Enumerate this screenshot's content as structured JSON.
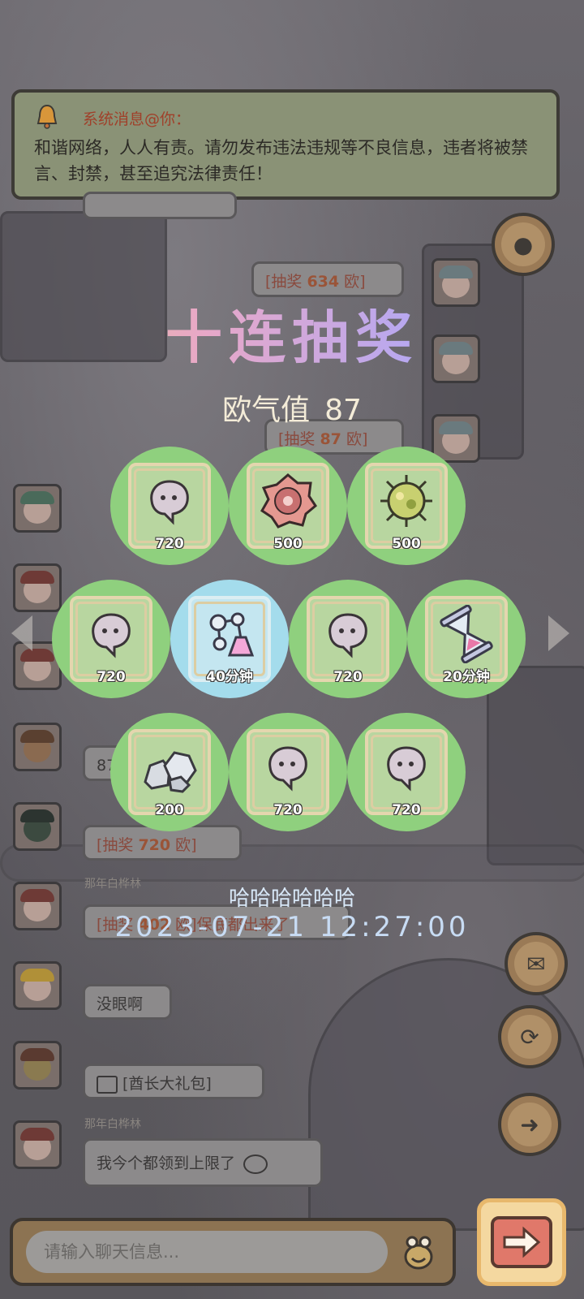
{
  "system_message": {
    "title": "系统消息@你：",
    "body": "和谐网络，人人有责。请勿发布违法违规等不良信息，违者将被禁言、封禁，甚至追究法律责任！"
  },
  "right_chat": [
    {
      "prefix": "[抽奖 ",
      "num": "634",
      "suffix": " 欧]"
    },
    {
      "prefix": "[抽奖 ",
      "num": "87",
      "suffix": " 欧]"
    }
  ],
  "left_chat": {
    "lottery_row": {
      "prefix": "[抽奖 ",
      "num": "720",
      "suffix": " 欧]"
    },
    "lottery_row2": {
      "prefix": "[抽奖 ",
      "num": "402",
      "suffix": " 欧]"
    },
    "partial_87": "87",
    "bubble_meiyan": "没眼啊",
    "bubble_gift": "[酋长大礼包]",
    "bubble_limit": "我今个都领到上限了",
    "username": "那年白桦林",
    "overlap_text": "保底都出来了"
  },
  "popup": {
    "title": "十连抽奖",
    "luck_label": "欧气值",
    "luck_value": "87",
    "rewards": [
      {
        "icon": "soul-blob-icon",
        "qty": "720",
        "style": "green"
      },
      {
        "icon": "red-virus-shell-icon",
        "qty": "500",
        "style": "green"
      },
      {
        "icon": "green-virus-cell-icon",
        "qty": "500",
        "style": "green"
      },
      {
        "icon": "soul-blob-icon",
        "qty": "720",
        "style": "green"
      },
      {
        "icon": "molecule-flask-icon",
        "qty": "40分钟",
        "style": "blue"
      },
      {
        "icon": "soul-blob-icon",
        "qty": "720",
        "style": "green"
      },
      {
        "icon": "hourglass-icon",
        "qty": "20分钟",
        "style": "green"
      },
      {
        "icon": "stone-pile-icon",
        "qty": "200",
        "style": "green"
      },
      {
        "icon": "soul-blob-icon",
        "qty": "720",
        "style": "green"
      },
      {
        "icon": "soul-blob-icon",
        "qty": "720",
        "style": "green"
      }
    ],
    "caption": "哈哈哈哈哈哈",
    "timestamp": "2023-07-21  12:27:00"
  },
  "chat_input": {
    "placeholder": "请输入聊天信息..."
  }
}
